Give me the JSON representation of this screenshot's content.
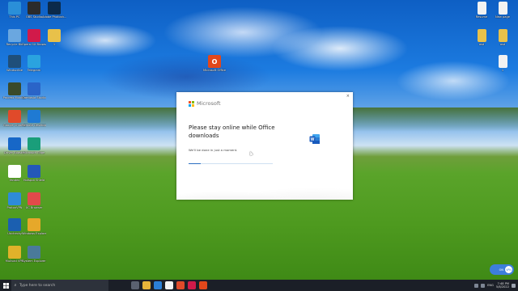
{
  "desktop": {
    "left_icons": [
      {
        "label": "This PC",
        "icon": "computer-icon",
        "color": "#2a8fd8"
      },
      {
        "label": "OBS Studio",
        "icon": "obs-icon",
        "color": "#2b2b2b"
      },
      {
        "label": "Adobe Photosh...",
        "icon": "photoshop-icon",
        "color": "#0b2a4a"
      },
      {
        "label": "Recycle Bin",
        "icon": "recycle-bin-icon",
        "color": "#6aa7e0"
      },
      {
        "label": "Opera GX Browser",
        "icon": "opera-gx-icon",
        "color": "#d11a4a"
      },
      {
        "label": "1",
        "icon": "folder-icon",
        "color": "#e8c14a"
      },
      {
        "label": "Windscribe",
        "icon": "windscribe-icon",
        "color": "#1f4f7a"
      },
      {
        "label": "Telegram",
        "icon": "telegram-icon",
        "color": "#2aa3df"
      },
      {
        "label": "Process Monitor",
        "icon": "process-monitor-icon",
        "color": "#3a4a2a"
      },
      {
        "label": "Camtasia Studio",
        "icon": "camtasia-icon",
        "color": "#2a64c8"
      },
      {
        "label": "Google Chrome",
        "icon": "chrome-icon",
        "color": "#e04a2a"
      },
      {
        "label": "Remote Desktop",
        "icon": "remote-desktop-icon",
        "color": "#1f7ad3"
      },
      {
        "label": "Driver Booster",
        "icon": "driver-booster-icon",
        "color": "#1767c7"
      },
      {
        "label": "Microsoft Edge",
        "icon": "edge-icon",
        "color": "#1a9e7a"
      },
      {
        "label": "Yandex",
        "icon": "yandex-icon",
        "color": "#ffffff"
      },
      {
        "label": "Hotspot Shield",
        "icon": "hotspot-icon",
        "color": "#2458b8"
      },
      {
        "label": "ProtonVPN",
        "icon": "protonvpn-icon",
        "color": "#2e8bd8"
      },
      {
        "label": "UC Browser",
        "icon": "uc-browser-icon",
        "color": "#e14a4a"
      },
      {
        "label": "Unchecky",
        "icon": "unchecky-icon",
        "color": "#1b5fb0"
      },
      {
        "label": "Windows Explorer",
        "icon": "explorer-icon",
        "color": "#e6a82a"
      },
      {
        "label": "Mullvad VPN",
        "icon": "mullvad-icon",
        "color": "#e0b22a"
      },
      {
        "label": "System Explorer",
        "icon": "system-explorer-icon",
        "color": "#4a7a9a"
      }
    ],
    "right_icons": [
      {
        "label": "Resume",
        "icon": "document-icon",
        "color": "#f2f2f2"
      },
      {
        "label": "New page",
        "icon": "document-icon",
        "color": "#f2f2f2"
      },
      {
        "label": "asd",
        "icon": "folder-icon",
        "color": "#e8c14a"
      },
      {
        "label": "asd",
        "icon": "folder-icon",
        "color": "#e8c14a"
      },
      {
        "label": "1",
        "icon": "document-icon",
        "color": "#f2f2f2"
      }
    ],
    "center_icon": {
      "label": "Microsoft Office",
      "icon": "office-icon",
      "color": "#e2471b"
    }
  },
  "dialog": {
    "brand": "Microsoft",
    "close_glyph": "×",
    "title": "Please stay online while Office downloads",
    "subtitle": "We'll be done in just a moment.",
    "progress_fraction": 0.14,
    "logo_colors": [
      "#f25022",
      "#7fba00",
      "#00a4ef",
      "#ffb900"
    ],
    "word_color": "#185abd"
  },
  "taskbar": {
    "search_placeholder": "Type here to search",
    "apps": [
      {
        "name": "task-view-icon",
        "color": "#5a6170"
      },
      {
        "name": "file-explorer-icon",
        "color": "#e6b33a"
      },
      {
        "name": "edge-taskbar-icon",
        "color": "#2b7fd6"
      },
      {
        "name": "yandex-taskbar-icon",
        "color": "#f3f3f3"
      },
      {
        "name": "chrome-taskbar-icon",
        "color": "#e04a2a"
      },
      {
        "name": "opera-taskbar-icon",
        "color": "#d11a4a"
      },
      {
        "name": "office-taskbar-icon",
        "color": "#e2471b"
      }
    ],
    "time": "7:48 PM",
    "date": "5/8/2022",
    "language": "ENG"
  },
  "vpn_toggle": {
    "label": "ON",
    "knob_text": "VPN"
  }
}
